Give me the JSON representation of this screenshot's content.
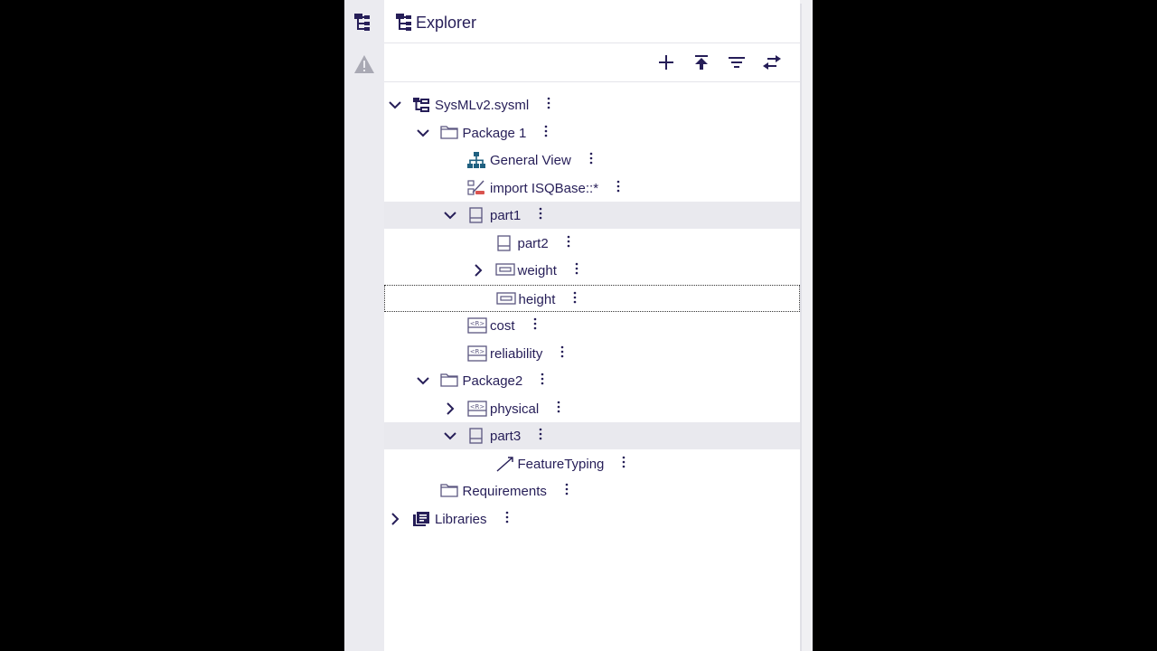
{
  "colors": {
    "accent": "#261e58",
    "background": "#ffffff",
    "selected_row": "#e9e9ee",
    "rail": "#ebebf0"
  },
  "rail": {
    "items": [
      {
        "icon": "explorer-icon"
      },
      {
        "icon": "warning-icon"
      }
    ]
  },
  "header": {
    "title": "Explorer",
    "icon": "explorer-icon"
  },
  "toolbar": {
    "buttons": [
      {
        "name": "new-model-button",
        "icon": "plus-icon"
      },
      {
        "name": "upload-button",
        "icon": "upload-icon"
      },
      {
        "name": "filter-button",
        "icon": "filter-icon"
      },
      {
        "name": "synchronize-button",
        "icon": "swap-arrows-icon"
      }
    ]
  },
  "tree": {
    "items": [
      {
        "label": "SysMLv2.sysml",
        "depth": 0,
        "expander": "expanded",
        "icon": "model-icon"
      },
      {
        "label": "Package 1",
        "depth": 1,
        "expander": "expanded",
        "icon": "folder-icon"
      },
      {
        "label": "General View",
        "depth": 2,
        "expander": "none",
        "icon": "diagram-icon"
      },
      {
        "label": "import ISQBase::*",
        "depth": 2,
        "expander": "none",
        "icon": "import-icon"
      },
      {
        "label": "part1",
        "depth": 2,
        "expander": "expanded",
        "icon": "part-icon",
        "selected": true
      },
      {
        "label": "part2",
        "depth": 3,
        "expander": "none",
        "icon": "part-icon"
      },
      {
        "label": "weight",
        "depth": 3,
        "expander": "collapsed",
        "icon": "attribute-icon"
      },
      {
        "label": "height",
        "depth": 3,
        "expander": "none",
        "icon": "attribute-icon",
        "focused": true
      },
      {
        "label": "cost",
        "depth": 2,
        "expander": "none",
        "icon": "requirement-icon"
      },
      {
        "label": "reliability",
        "depth": 2,
        "expander": "none",
        "icon": "requirement-icon"
      },
      {
        "label": "Package2",
        "depth": 1,
        "expander": "expanded",
        "icon": "folder-icon"
      },
      {
        "label": "physical",
        "depth": 2,
        "expander": "collapsed",
        "icon": "requirement-icon"
      },
      {
        "label": "part3",
        "depth": 2,
        "expander": "expanded",
        "icon": "part-icon",
        "selected": true
      },
      {
        "label": "FeatureTyping",
        "depth": 3,
        "expander": "none",
        "icon": "relationship-icon"
      },
      {
        "label": "Requirements",
        "depth": 1,
        "expander": "none",
        "icon": "folder-icon"
      },
      {
        "label": "Libraries",
        "depth": 0,
        "expander": "collapsed",
        "icon": "library-icon"
      }
    ]
  }
}
